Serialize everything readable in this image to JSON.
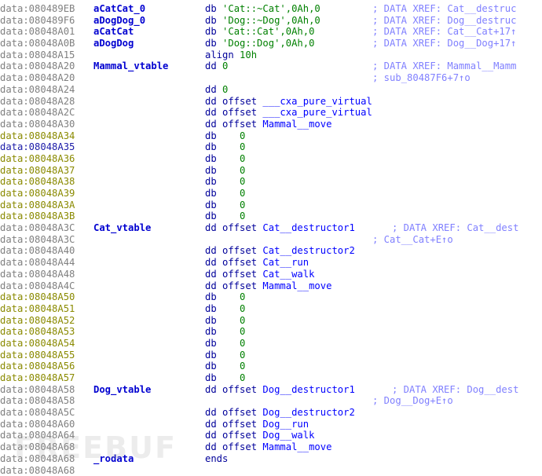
{
  "rows": [
    {
      "addr": "data:080489EB",
      "addrStyle": "grey",
      "label": "aCatCat_0",
      "op": "db",
      "operand": "'Cat::~Cat',0Ah,0",
      "comment": "; DATA XREF: Cat__destruc",
      "commentCol": 474
    },
    {
      "addr": "data:080489F6",
      "addrStyle": "grey",
      "label": "aDogDog_0",
      "op": "db",
      "operand": "'Dog::~Dog',0Ah,0",
      "comment": "; DATA XREF: Dog__destruc",
      "commentCol": 474
    },
    {
      "addr": "data:08048A01",
      "addrStyle": "grey",
      "label": "aCatCat",
      "op": "db",
      "operand": "'Cat::Cat',0Ah,0",
      "comment": "; DATA XREF: Cat__Cat+17↑",
      "commentCol": 474
    },
    {
      "addr": "data:08048A0B",
      "addrStyle": "grey",
      "label": "aDogDog",
      "op": "db",
      "operand": "'Dog::Dog',0Ah,0",
      "comment": "; DATA XREF: Dog__Dog+17↑",
      "commentCol": 474
    },
    {
      "addr": "data:08048A15",
      "addrStyle": "grey",
      "label": "",
      "op": "align",
      "operand": "10h",
      "comment": "",
      "commentCol": 0
    },
    {
      "addr": "data:08048A20",
      "addrStyle": "grey",
      "label": "Mammal_vtable",
      "op": "dd",
      "operand": "0",
      "comment": "; DATA XREF: Mammal__Mamm",
      "commentCol": 474
    },
    {
      "addr": "data:08048A20",
      "addrStyle": "grey",
      "label": "",
      "op": "",
      "operand": "",
      "comment": "; sub_80487F6+7↑o",
      "commentCol": 474
    },
    {
      "addr": "data:08048A24",
      "addrStyle": "grey",
      "label": "",
      "op": "dd",
      "operand": "0",
      "comment": "",
      "commentCol": 0
    },
    {
      "addr": "data:08048A28",
      "addrStyle": "grey",
      "label": "",
      "op": "dd offset",
      "operand": "___cxa_pure_virtual",
      "comment": "",
      "commentCol": 0
    },
    {
      "addr": "data:08048A2C",
      "addrStyle": "grey",
      "label": "",
      "op": "dd offset",
      "operand": "___cxa_pure_virtual",
      "comment": "",
      "commentCol": 0
    },
    {
      "addr": "data:08048A30",
      "addrStyle": "grey",
      "label": "",
      "op": "dd offset",
      "operand": "Mammal__move",
      "comment": "",
      "commentCol": 0
    },
    {
      "addr": "data:08048A34",
      "addrStyle": "yellow",
      "label": "",
      "op": "db",
      "operand": "   0",
      "comment": "",
      "commentCol": 0
    },
    {
      "addr": "data:08048A35",
      "addrStyle": "blue",
      "label": "",
      "op": "db",
      "operand": "   0",
      "comment": "",
      "commentCol": 0
    },
    {
      "addr": "data:08048A36",
      "addrStyle": "yellow",
      "label": "",
      "op": "db",
      "operand": "   0",
      "comment": "",
      "commentCol": 0
    },
    {
      "addr": "data:08048A37",
      "addrStyle": "yellow",
      "label": "",
      "op": "db",
      "operand": "   0",
      "comment": "",
      "commentCol": 0
    },
    {
      "addr": "data:08048A38",
      "addrStyle": "yellow",
      "label": "",
      "op": "db",
      "operand": "   0",
      "comment": "",
      "commentCol": 0
    },
    {
      "addr": "data:08048A39",
      "addrStyle": "yellow",
      "label": "",
      "op": "db",
      "operand": "   0",
      "comment": "",
      "commentCol": 0
    },
    {
      "addr": "data:08048A3A",
      "addrStyle": "yellow",
      "label": "",
      "op": "db",
      "operand": "   0",
      "comment": "",
      "commentCol": 0
    },
    {
      "addr": "data:08048A3B",
      "addrStyle": "yellow",
      "label": "",
      "op": "db",
      "operand": "   0",
      "comment": "",
      "commentCol": 0
    },
    {
      "addr": "data:08048A3C",
      "addrStyle": "grey",
      "label": "Cat_vtable",
      "op": "dd offset",
      "operand": "Cat__destructor1",
      "comment": "; DATA XREF: Cat__dest",
      "commentCol": 499
    },
    {
      "addr": "data:08048A3C",
      "addrStyle": "grey",
      "label": "",
      "op": "",
      "operand": "",
      "comment": "; Cat__Cat+E↑o",
      "commentCol": 474
    },
    {
      "addr": "data:08048A40",
      "addrStyle": "grey",
      "label": "",
      "op": "dd offset",
      "operand": "Cat__destructor2",
      "comment": "",
      "commentCol": 0
    },
    {
      "addr": "data:08048A44",
      "addrStyle": "grey",
      "label": "",
      "op": "dd offset",
      "operand": "Cat__run",
      "comment": "",
      "commentCol": 0
    },
    {
      "addr": "data:08048A48",
      "addrStyle": "grey",
      "label": "",
      "op": "dd offset",
      "operand": "Cat__walk",
      "comment": "",
      "commentCol": 0
    },
    {
      "addr": "data:08048A4C",
      "addrStyle": "grey",
      "label": "",
      "op": "dd offset",
      "operand": "Mammal__move",
      "comment": "",
      "commentCol": 0
    },
    {
      "addr": "data:08048A50",
      "addrStyle": "yellow",
      "label": "",
      "op": "db",
      "operand": "   0",
      "comment": "",
      "commentCol": 0
    },
    {
      "addr": "data:08048A51",
      "addrStyle": "yellow",
      "label": "",
      "op": "db",
      "operand": "   0",
      "comment": "",
      "commentCol": 0
    },
    {
      "addr": "data:08048A52",
      "addrStyle": "yellow",
      "label": "",
      "op": "db",
      "operand": "   0",
      "comment": "",
      "commentCol": 0
    },
    {
      "addr": "data:08048A53",
      "addrStyle": "yellow",
      "label": "",
      "op": "db",
      "operand": "   0",
      "comment": "",
      "commentCol": 0
    },
    {
      "addr": "data:08048A54",
      "addrStyle": "yellow",
      "label": "",
      "op": "db",
      "operand": "   0",
      "comment": "",
      "commentCol": 0
    },
    {
      "addr": "data:08048A55",
      "addrStyle": "yellow",
      "label": "",
      "op": "db",
      "operand": "   0",
      "comment": "",
      "commentCol": 0
    },
    {
      "addr": "data:08048A56",
      "addrStyle": "yellow",
      "label": "",
      "op": "db",
      "operand": "   0",
      "comment": "",
      "commentCol": 0
    },
    {
      "addr": "data:08048A57",
      "addrStyle": "yellow",
      "label": "",
      "op": "db",
      "operand": "   0",
      "comment": "",
      "commentCol": 0
    },
    {
      "addr": "data:08048A58",
      "addrStyle": "grey",
      "label": "Dog_vtable",
      "op": "dd offset",
      "operand": "Dog__destructor1",
      "comment": "; DATA XREF: Dog__dest",
      "commentCol": 499
    },
    {
      "addr": "data:08048A58",
      "addrStyle": "grey",
      "label": "",
      "op": "",
      "operand": "",
      "comment": "; Dog__Dog+E↑o",
      "commentCol": 474
    },
    {
      "addr": "data:08048A5C",
      "addrStyle": "grey",
      "label": "",
      "op": "dd offset",
      "operand": "Dog__destructor2",
      "comment": "",
      "commentCol": 0
    },
    {
      "addr": "data:08048A60",
      "addrStyle": "grey",
      "label": "",
      "op": "dd offset",
      "operand": "Dog__run",
      "comment": "",
      "commentCol": 0
    },
    {
      "addr": "data:08048A64",
      "addrStyle": "grey",
      "label": "",
      "op": "dd offset",
      "operand": "Dog__walk",
      "comment": "",
      "commentCol": 0
    },
    {
      "addr": "data:08048A68",
      "addrStyle": "grey",
      "label": "",
      "op": "dd offset",
      "operand": "Mammal__move",
      "comment": "",
      "commentCol": 0
    },
    {
      "addr": "data:08048A68",
      "addrStyle": "grey",
      "label": "_rodata",
      "op": "ends",
      "operand": "",
      "comment": "",
      "commentCol": 0
    },
    {
      "addr": "data:08048A68",
      "addrStyle": "grey",
      "label": "",
      "op": "",
      "operand": "",
      "comment": "",
      "commentCol": 0
    }
  ],
  "watermark": "FREEBUF"
}
